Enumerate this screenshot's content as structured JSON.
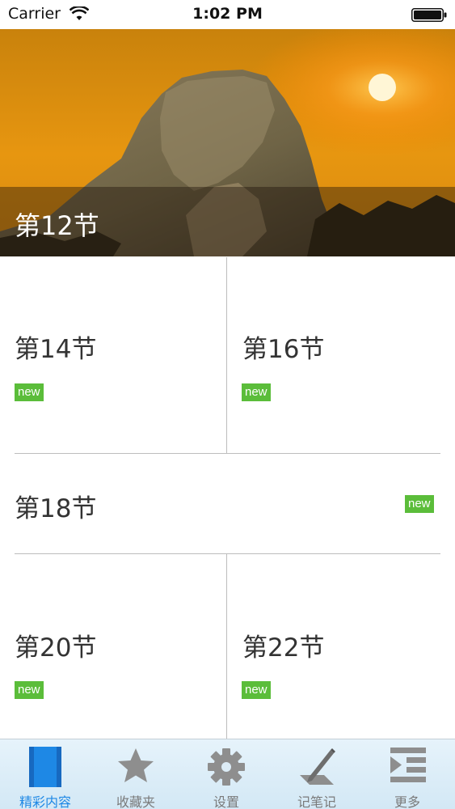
{
  "status_bar": {
    "carrier": "Carrier",
    "time": "1:02 PM"
  },
  "hero": {
    "title": "第12节"
  },
  "grid": {
    "items": [
      {
        "title": "第14节",
        "badge": "new"
      },
      {
        "title": "第16节",
        "badge": "new"
      },
      {
        "title": "第18节",
        "badge": "new"
      },
      {
        "title": "第20节",
        "badge": "new"
      },
      {
        "title": "第22节",
        "badge": "new"
      }
    ]
  },
  "tab_bar": {
    "tabs": [
      {
        "label": "精彩内容",
        "icon": "book-icon",
        "active": true
      },
      {
        "label": "收藏夹",
        "icon": "star-icon",
        "active": false
      },
      {
        "label": "设置",
        "icon": "gear-icon",
        "active": false
      },
      {
        "label": "记笔记",
        "icon": "pencil-note-icon",
        "active": false
      },
      {
        "label": "更多",
        "icon": "list-more-icon",
        "active": false
      }
    ]
  },
  "colors": {
    "badge": "#5bbd3a",
    "active_tab": "#1e88e5",
    "inactive_tab": "#7a7a7a"
  }
}
